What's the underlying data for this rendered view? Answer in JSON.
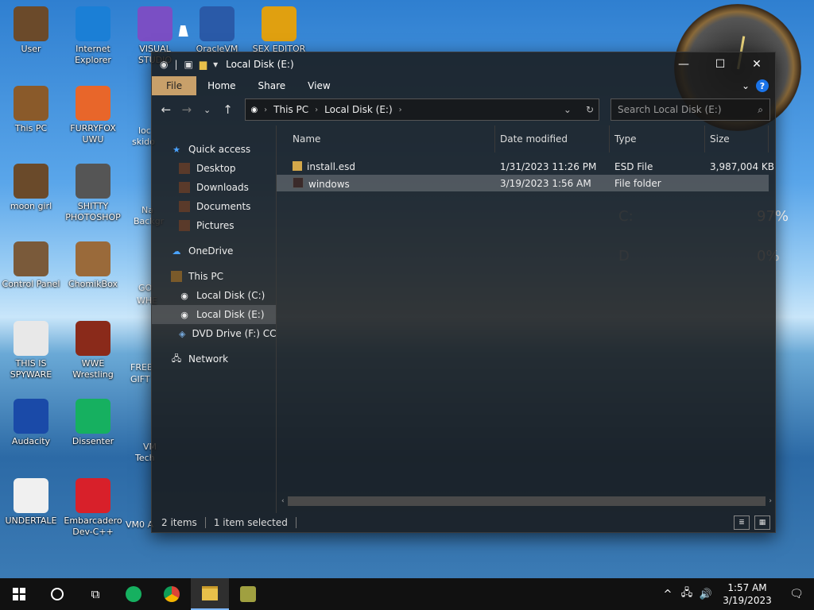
{
  "desktop": {
    "icons": [
      {
        "label": "User",
        "color": "#6b4a2a"
      },
      {
        "label": "Internet Explorer",
        "color": "#1b7fd6"
      },
      {
        "label": "VISUAL STUDIO",
        "color": "#7a4fc4"
      },
      {
        "label": "OracleVM",
        "color": "#2a5aa8"
      },
      {
        "label": "SEX EDITOR",
        "color": "#e0a010"
      },
      {
        "label": "This PC",
        "color": "#8a5a2a"
      },
      {
        "label": "FURRYFOX UWU",
        "color": "#e8662a"
      },
      {
        "label": "moon girl",
        "color": "#6a4a2a"
      },
      {
        "label": "SHITTY PHOTOSHOP",
        "color": "#555555"
      },
      {
        "label": "Control Panel",
        "color": "#7a5a3a"
      },
      {
        "label": "ChomikBox",
        "color": "#9a6a3a"
      },
      {
        "label": "THIS IS SPYWARE",
        "color": "#e8e8e8"
      },
      {
        "label": "WWE Wrestling",
        "color": "#8a2a1a"
      },
      {
        "label": "Audacity",
        "color": "#1a4aa8"
      },
      {
        "label": "Dissenter",
        "color": "#16b060"
      },
      {
        "label": "UNDERTALE",
        "color": "#f0f0f0"
      },
      {
        "label": "Embarcadero Dev-C++",
        "color": "#d8202a"
      }
    ],
    "partial_labels": {
      "loc": "loc",
      "ski": "skido",
      "na": "Na",
      "back": "Backgr",
      "go": "GO",
      "wh": "WHE",
      "free": "FREE",
      "gift": "GIFT",
      "vm": "VM",
      "tech": "Tech",
      "vm0": "VM0 A"
    },
    "meters": {
      "c_label": "C:",
      "c_value": "97%",
      "d_label": "D",
      "d_value": "0%"
    }
  },
  "explorer": {
    "title": "Local Disk (E:)",
    "controls": {
      "minimize": "—",
      "maximize": "☐",
      "close": "✕"
    },
    "ribbon_tabs": [
      "File",
      "Home",
      "Share",
      "View"
    ],
    "breadcrumb": [
      "This PC",
      "Local Disk (E:)"
    ],
    "search_placeholder": "Search Local Disk (E:)",
    "nav": {
      "quick_access": "Quick access",
      "desktop": "Desktop",
      "downloads": "Downloads",
      "documents": "Documents",
      "pictures": "Pictures",
      "onedrive": "OneDrive",
      "this_pc": "This PC",
      "local_c": "Local Disk (C:)",
      "local_e": "Local Disk (E:)",
      "dvd": "DVD Drive (F:) CCSA",
      "network": "Network"
    },
    "columns": {
      "name": "Name",
      "date": "Date modified",
      "type": "Type",
      "size": "Size"
    },
    "files": [
      {
        "name": "install.esd",
        "date": "1/31/2023 11:26 PM",
        "type": "ESD File",
        "size": "3,987,004 KB"
      },
      {
        "name": "windows",
        "date": "3/19/2023 1:56 AM",
        "type": "File folder",
        "size": ""
      }
    ],
    "status": {
      "count": "2 items",
      "selected": "1 item selected"
    }
  },
  "taskbar": {
    "time": "1:57 AM",
    "date": "3/19/2023"
  }
}
